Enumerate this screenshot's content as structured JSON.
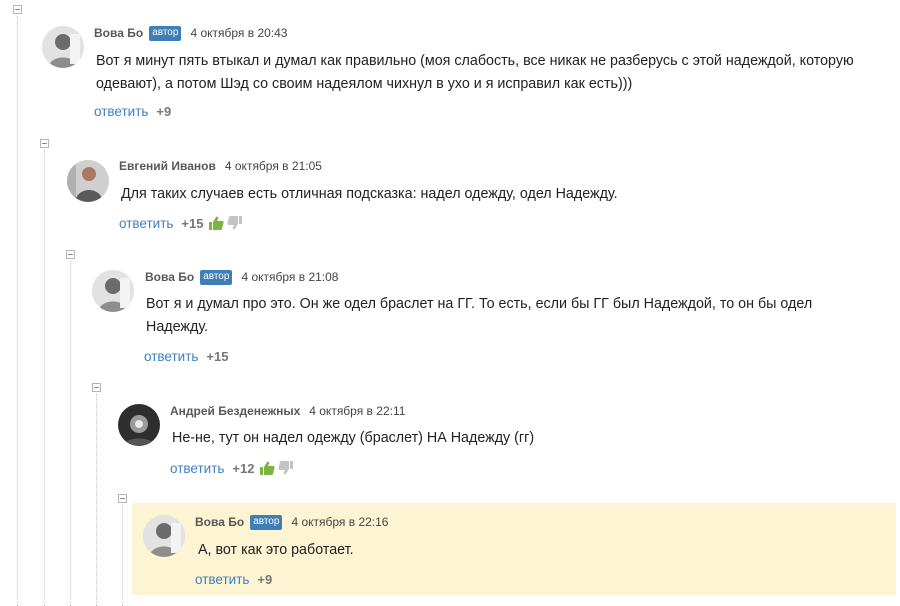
{
  "colors": {
    "link": "#3f7fbd",
    "badge": "#3e7fb5",
    "highlight": "#fcf4d2",
    "vote_up": "#7cb342",
    "vote_down": "#c4c4c4"
  },
  "comments": [
    {
      "author": "Вова Бо",
      "badge": "автор",
      "date": "4 октября в 20:43",
      "text": "Вот я минут пять втыкал и думал как правильно (моя слабость, все никак не разберусь с этой надеждой, которую одевают), а потом Шэд со своим надеялом чихнул в ухо и я исправил как есть)))",
      "reply": "ответить",
      "score": "+9",
      "avatar_icon": "user-avatar"
    },
    {
      "author": "Евгений Иванов",
      "date": "4 октября в 21:05",
      "text": "Для таких случаев есть отличная подсказка: надел одежду, одел Надежду.",
      "reply": "ответить",
      "score": "+15",
      "vote_icons": [
        "thumbs-up-icon",
        "thumbs-down-icon"
      ],
      "avatar_icon": "user-avatar"
    },
    {
      "author": "Вова Бо",
      "badge": "автор",
      "date": "4 октября в 21:08",
      "text": "Вот я и думал про это. Он же одел браслет на ГГ. То есть, если бы ГГ был Надеждой, то он бы одел Надежду.",
      "reply": "ответить",
      "score": "+15",
      "avatar_icon": "user-avatar"
    },
    {
      "author": "Андрей Безденежных",
      "date": "4 октября в 22:11",
      "text": "Не-не, тут он надел одежду (браслет) НА Надежду (гг)",
      "reply": "ответить",
      "score": "+12",
      "vote_icons": [
        "thumbs-up-icon",
        "thumbs-down-icon"
      ],
      "avatar_icon": "user-avatar"
    },
    {
      "author": "Вова Бо",
      "badge": "автор",
      "date": "4 октября в 22:16",
      "text": "А, вот как это работает.",
      "reply": "ответить",
      "score": "+9",
      "avatar_icon": "user-avatar",
      "highlighted": true
    }
  ]
}
